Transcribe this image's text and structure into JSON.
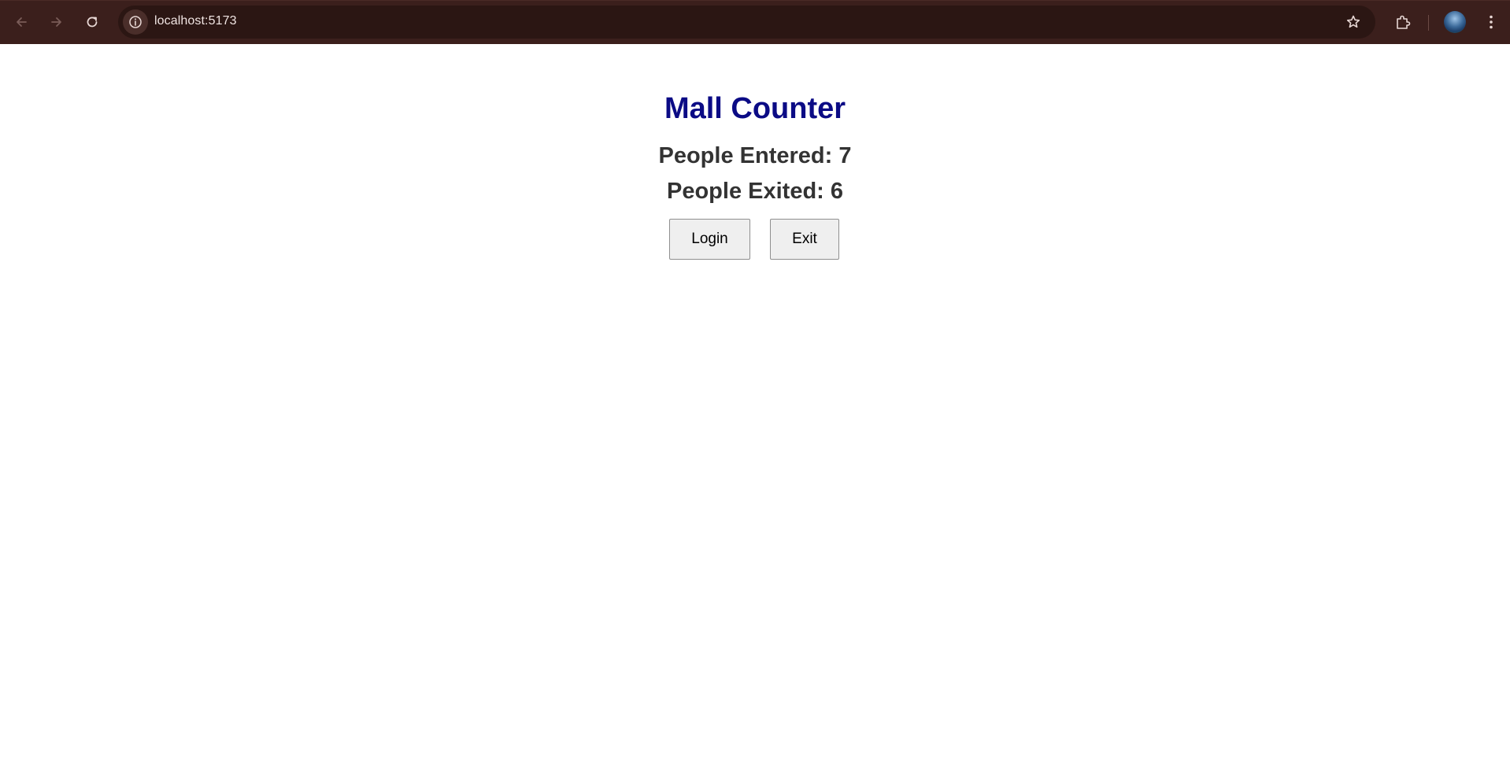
{
  "browser": {
    "url": "localhost:5173",
    "icons": {
      "back": "arrow-left-icon",
      "forward": "arrow-right-icon",
      "reload": "reload-icon",
      "site_info": "info-icon",
      "bookmark": "star-icon",
      "extensions": "puzzle-icon",
      "menu": "kebab-menu-icon"
    },
    "colors": {
      "toolbar": "#3b1f1c",
      "omnibox": "#2b1613"
    }
  },
  "app": {
    "title": "Mall Counter",
    "entered_label": "People Entered:",
    "entered_count": "7",
    "exited_label": "People Exited:",
    "exited_count": "6",
    "buttons": {
      "login": "Login",
      "exit": "Exit"
    },
    "colors": {
      "title": "#0b0b85",
      "stat_text": "#333333",
      "button_bg": "#efefef"
    }
  }
}
